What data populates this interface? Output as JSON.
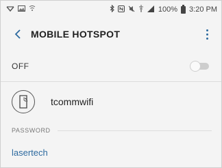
{
  "status_bar": {
    "battery": "100%",
    "time": "3:20 PM",
    "icons": [
      "notification-icon",
      "gallery-icon",
      "bluetooth-icon",
      "nfc-icon",
      "mute-icon",
      "data-saver-icon",
      "signal-icon",
      "battery-icon"
    ]
  },
  "app_bar": {
    "title": "MOBILE HOTSPOT"
  },
  "hotspot": {
    "state_label": "OFF",
    "enabled": false,
    "network_name": "tcommwifi"
  },
  "password": {
    "header": "PASSWORD",
    "value": "lasertech"
  },
  "colors": {
    "accent": "#2d6a9f",
    "background": "#f4f4f4",
    "divider": "#dcdcdc"
  }
}
